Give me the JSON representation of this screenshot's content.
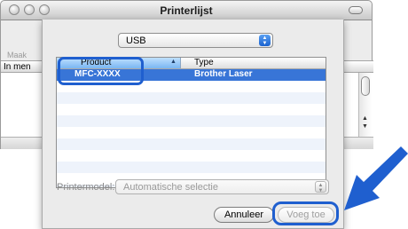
{
  "window": {
    "title": "Printerlijst",
    "toolbar_label": "Maak",
    "column_label": "In men"
  },
  "sheet": {
    "connection_popup": {
      "value": "USB"
    },
    "list": {
      "headers": {
        "product": "Product",
        "type": "Type"
      },
      "rows": [
        {
          "product": "MFC-XXXX",
          "type": "Brother Laser",
          "selected": true
        }
      ]
    },
    "printer_model": {
      "label": "Printermodel:",
      "value": "Automatische selectie"
    },
    "buttons": {
      "cancel": "Annuleer",
      "add": "Voeg toe"
    }
  },
  "colors": {
    "selection": "#3875d7",
    "highlight": "#1f5fcf"
  },
  "icons": [
    "close-icon",
    "minimize-icon",
    "zoom-icon",
    "toolbar-pill-icon",
    "popup-arrows-icon",
    "sort-arrow-icon",
    "callout-arrow-icon"
  ]
}
